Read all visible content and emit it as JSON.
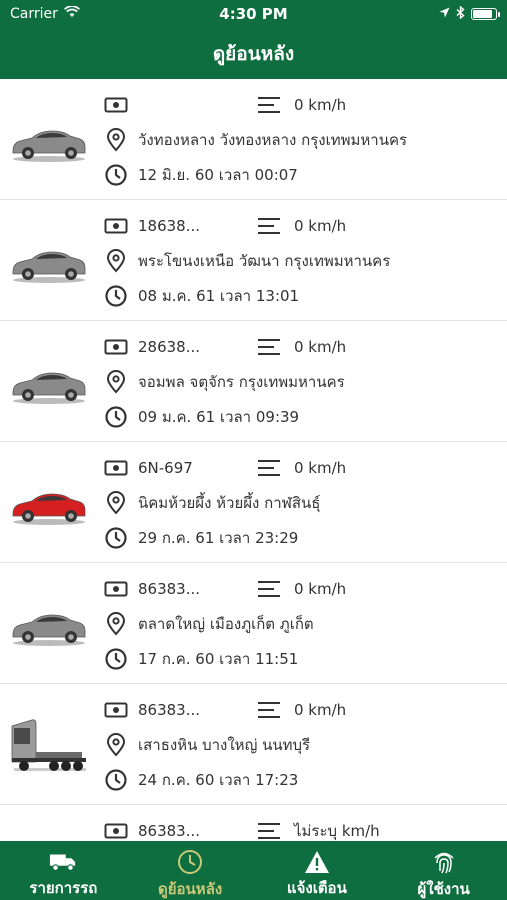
{
  "status_bar": {
    "carrier": "Carrier",
    "time": "4:30 PM",
    "battery_level": 0.85
  },
  "nav": {
    "title": "ดูย้อนหลัง"
  },
  "records": [
    {
      "vehicle": "car-gray",
      "plate": "",
      "speed": "0 km/h",
      "location": "วังทองหลาง วังทองหลาง กรุงเทพมหานคร",
      "datetime": "12 มิ.ย. 60 เวลา 00:07"
    },
    {
      "vehicle": "car-gray",
      "plate": "18638...",
      "speed": "0 km/h",
      "location": "พระโขนงเหนือ วัฒนา กรุงเทพมหานคร",
      "datetime": "08 ม.ค. 61 เวลา 13:01"
    },
    {
      "vehicle": "car-gray",
      "plate": "28638...",
      "speed": "0 km/h",
      "location": "จอมพล จตุจักร กรุงเทพมหานคร",
      "datetime": "09 ม.ค. 61 เวลา 09:39"
    },
    {
      "vehicle": "car-red",
      "plate": "6N-697",
      "speed": "0 km/h",
      "location": "นิคมห้วยผึ้ง ห้วยผึ้ง กาฬสินธุ์",
      "datetime": "29 ก.ค. 61 เวลา 23:29"
    },
    {
      "vehicle": "car-gray",
      "plate": "86383...",
      "speed": "0 km/h",
      "location": "ตลาดใหญ่ เมืองภูเก็ต ภูเก็ต",
      "datetime": "17 ก.ค. 60 เวลา 11:51"
    },
    {
      "vehicle": "truck",
      "plate": "86383...",
      "speed": "0 km/h",
      "location": "เสาธงหิน บางใหญ่ นนทบุรี",
      "datetime": "24 ก.ค. 60 เวลา 17:23"
    },
    {
      "vehicle": "car-gray",
      "plate": "86383...",
      "speed": "ไม่ระบุ km/h",
      "location": "",
      "datetime": ""
    }
  ],
  "tabs": [
    {
      "label": "รายการรถ",
      "icon": "truck-icon",
      "active": false
    },
    {
      "label": "ดูย้อนหลัง",
      "icon": "clock-icon",
      "active": true
    },
    {
      "label": "แจ้งเตือน",
      "icon": "warning-icon",
      "active": false
    },
    {
      "label": "ผู้ใช้งาน",
      "icon": "fingerprint-icon",
      "active": false
    }
  ],
  "colors": {
    "brand": "#0f6e3f",
    "active_tab": "#c8c877",
    "car_gray": "#8a8a8a",
    "car_red": "#d42020"
  }
}
